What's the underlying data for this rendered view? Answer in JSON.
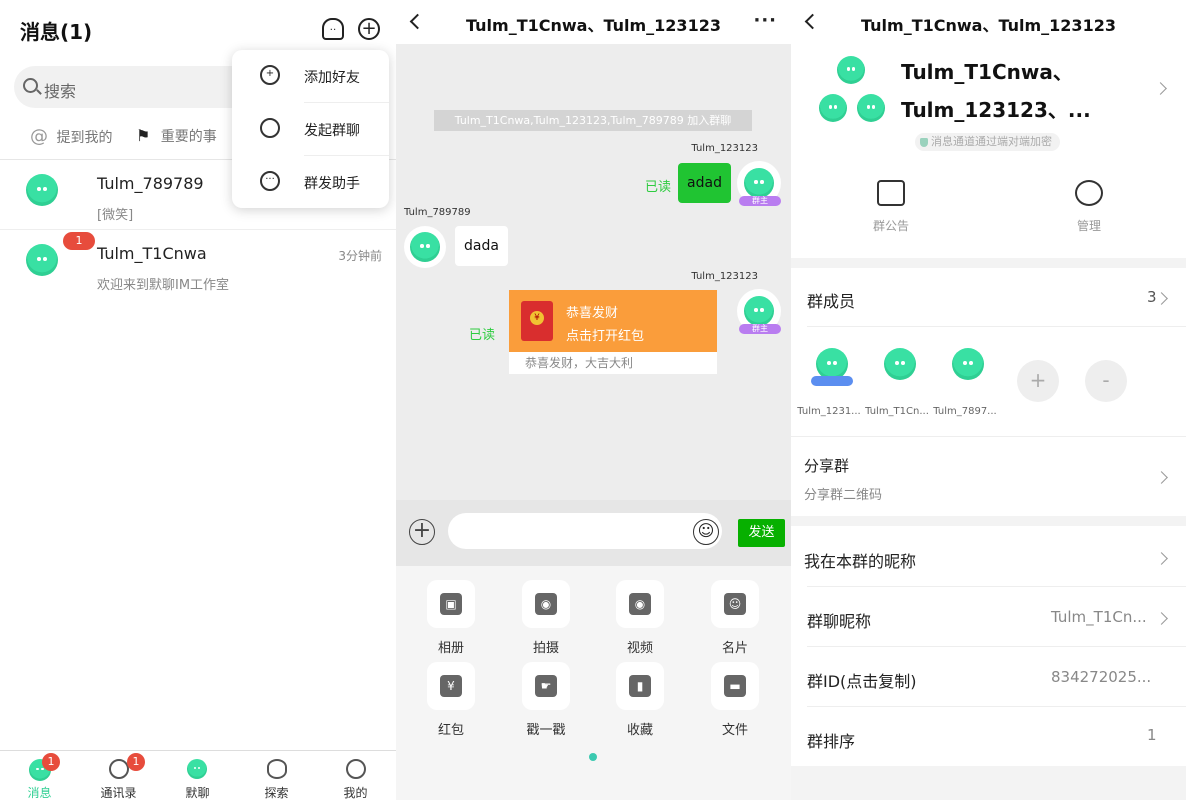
{
  "messages_panel": {
    "title": "消息(1)",
    "search_placeholder": "搜索",
    "filters": [
      "提到我的",
      "重要的事"
    ],
    "conversations": [
      {
        "name": "Tulm_789789",
        "preview": "[微笑]",
        "time": "",
        "badge": ""
      },
      {
        "name": "Tulm_T1Cnwa",
        "preview": "欢迎来到默聊IM工作室",
        "time": "3分钟前",
        "badge": "1"
      }
    ],
    "popup_menu": [
      "添加好友",
      "发起群聊",
      "群发助手"
    ],
    "tabs": [
      {
        "label": "消息",
        "badge": "1"
      },
      {
        "label": "通讯录",
        "badge": "1"
      },
      {
        "label": "默聊",
        "badge": ""
      },
      {
        "label": "探索",
        "badge": ""
      },
      {
        "label": "我的",
        "badge": ""
      }
    ]
  },
  "chat_panel": {
    "title": "Tulm_T1Cnwa、Tulm_123123...",
    "more_icon": "···",
    "system_message": "Tulm_T1Cnwa,Tulm_123123,Tulm_789789 加入群聊",
    "messages": [
      {
        "sender": "Tulm_123123",
        "text": "adad",
        "status": "已读",
        "tag": "群主"
      },
      {
        "sender": "Tulm_789789",
        "text": "dada"
      },
      {
        "sender": "Tulm_123123",
        "status": "已读",
        "tag": "群主",
        "red_packet": {
          "title": "恭喜发财",
          "action": "点击打开红包",
          "footer": "恭喜发财，大吉大利"
        }
      }
    ],
    "send_label": "发送",
    "tools": [
      "相册",
      "拍摄",
      "视频",
      "名片",
      "红包",
      "戳一戳",
      "收藏",
      "文件"
    ]
  },
  "settings_panel": {
    "title": "Tulm_T1Cnwa、Tulm_123123...",
    "group_name_line1": "Tulm_T1Cnwa、",
    "group_name_line2": "Tulm_123123、...",
    "encryption_note": "消息通道通过端对端加密",
    "actions": [
      "群公告",
      "管理"
    ],
    "members_label": "群成员",
    "members_count": "3",
    "members": [
      "Tulm_1231...",
      "Tulm_T1Cn...",
      "Tulm_7897..."
    ],
    "add_symbol": "+",
    "remove_symbol": "-",
    "share_title": "分享群",
    "share_subtitle": "分享群二维码",
    "my_nickname_label": "我在本群的昵称",
    "group_nickname_label": "群聊昵称",
    "group_nickname_value": "Tulm_T1Cn...",
    "group_id_label": "群ID(点击复制)",
    "group_id_value": "834272025...",
    "sort_label": "群排序",
    "sort_value": "1"
  },
  "colors": {
    "accent_green": "#07b000",
    "avatar_green": "#39e0a3",
    "badge_red": "#e74c3c",
    "red_packet": "#fa9d3b"
  }
}
